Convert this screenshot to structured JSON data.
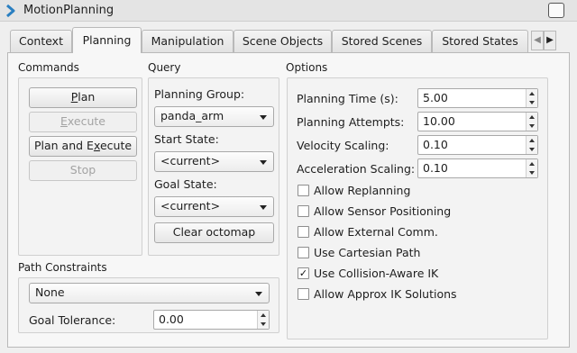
{
  "window": {
    "title": "MotionPlanning"
  },
  "tabs": [
    {
      "label": "Context"
    },
    {
      "label": "Planning"
    },
    {
      "label": "Manipulation"
    },
    {
      "label": "Scene Objects"
    },
    {
      "label": "Stored Scenes"
    },
    {
      "label": "Stored States"
    }
  ],
  "active_tab": "Planning",
  "commands": {
    "heading": "Commands",
    "plan_mnemonic": "P",
    "plan_rest": "lan",
    "execute_mnemonic": "E",
    "execute_rest": "xecute",
    "plan_execute_pre": "Plan and E",
    "plan_execute_mnemonic": "x",
    "plan_execute_post": "ecute",
    "stop_label": "Stop"
  },
  "query": {
    "heading": "Query",
    "planning_group_label": "Planning Group:",
    "planning_group_value": "panda_arm",
    "start_state_label": "Start State:",
    "start_state_value": "<current>",
    "goal_state_label": "Goal State:",
    "goal_state_value": "<current>",
    "clear_octomap_label": "Clear octomap"
  },
  "options": {
    "heading": "Options",
    "planning_time_label": "Planning Time (s):",
    "planning_time_value": "5.00",
    "planning_attempts_label": "Planning Attempts:",
    "planning_attempts_value": "10.00",
    "velocity_scaling_label": "Velocity Scaling:",
    "velocity_scaling_value": "0.10",
    "acceleration_scaling_label": "Acceleration Scaling:",
    "acceleration_scaling_value": "0.10",
    "checkboxes": [
      {
        "label": "Allow Replanning",
        "checked": false
      },
      {
        "label": "Allow Sensor Positioning",
        "checked": false
      },
      {
        "label": "Allow External Comm.",
        "checked": false
      },
      {
        "label": "Use Cartesian Path",
        "checked": false
      },
      {
        "label": "Use Collision-Aware IK",
        "checked": true
      },
      {
        "label": "Allow Approx IK Solutions",
        "checked": false
      }
    ]
  },
  "path_constraints": {
    "heading": "Path Constraints",
    "constraint_value": "None",
    "goal_tolerance_label": "Goal Tolerance:",
    "goal_tolerance_value": "0.00"
  },
  "check_glyph": "✓"
}
